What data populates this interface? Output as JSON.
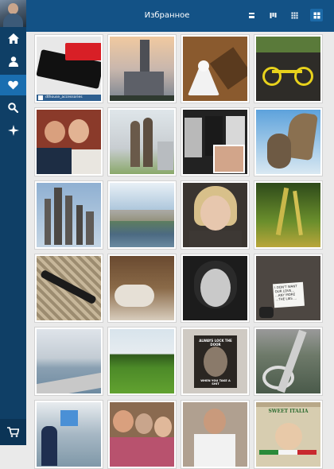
{
  "header": {
    "title": "Избранное"
  },
  "view_modes": [
    {
      "name": "view-list-icon",
      "active": false
    },
    {
      "name": "view-columns-icon",
      "active": false
    },
    {
      "name": "view-grid-small-icon",
      "active": false
    },
    {
      "name": "view-grid-large-icon",
      "active": true
    }
  ],
  "sidebar": {
    "items": [
      {
        "icon": "home-icon",
        "active": false
      },
      {
        "icon": "profile-icon",
        "active": false
      },
      {
        "icon": "heart-icon",
        "active": true
      },
      {
        "icon": "search-icon",
        "active": false
      },
      {
        "icon": "explore-icon",
        "active": false
      }
    ],
    "cart_icon": "cart-icon"
  },
  "photos": {
    "p1_caption": "dthouse_accessories",
    "p19_note": "I DON'T WANT OUR LOVE... ...ANY MORE ...THE LIES ...",
    "p23_top": "ALWAYS LOCK THE DOOR",
    "p23_bottom": "WHEN YOU TAKE A SHIT",
    "p28_text": "SWEET ITALIA"
  },
  "colors": {
    "topbar": "#135286",
    "sidebar": "#0f3f66",
    "active": "#1a6eb0",
    "background": "#eaeaea"
  }
}
